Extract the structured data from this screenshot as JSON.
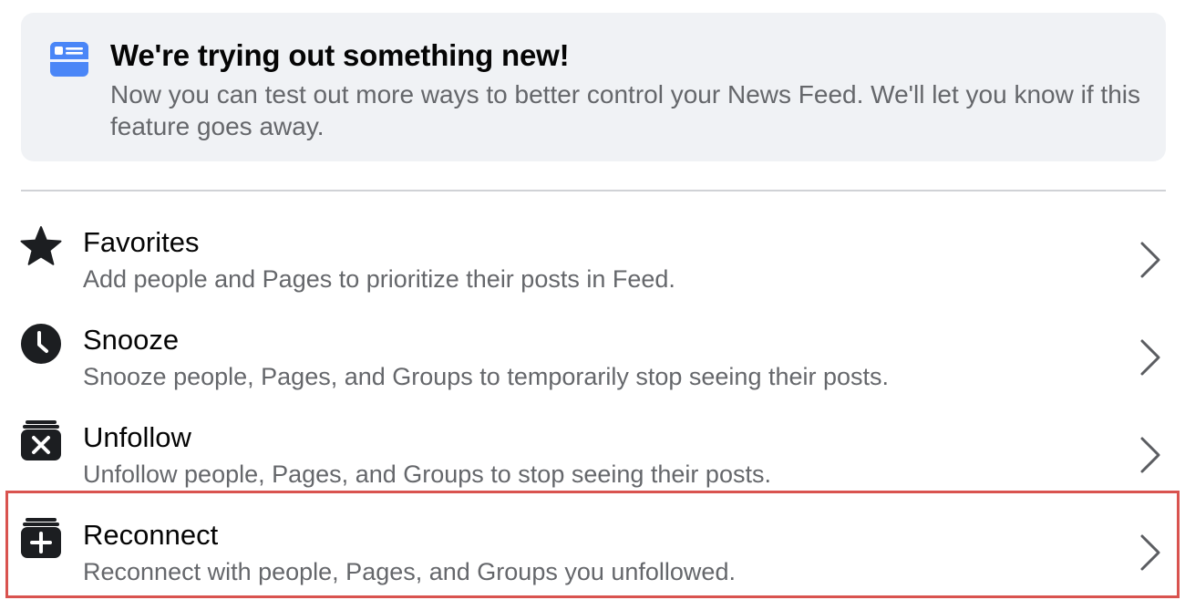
{
  "notice": {
    "icon": "news-feed-icon",
    "title": "We're trying out something new!",
    "body": "Now you can test out more ways to better control your News Feed. We'll let you know if this feature goes away.",
    "icon_color": "#4a86f7"
  },
  "items": [
    {
      "icon": "star-icon",
      "title": "Favorites",
      "description": "Add people and Pages to prioritize their posts in Feed."
    },
    {
      "icon": "clock-icon",
      "title": "Snooze",
      "description": "Snooze people, Pages, and Groups to temporarily stop seeing their posts."
    },
    {
      "icon": "unfollow-icon",
      "title": "Unfollow",
      "description": "Unfollow people, Pages, and Groups to stop seeing their posts."
    },
    {
      "icon": "reconnect-icon",
      "title": "Reconnect",
      "description": "Reconnect with people, Pages, and Groups you unfollowed.",
      "highlighted": true
    }
  ],
  "colors": {
    "highlight_border": "#d9534f",
    "secondary_text": "#65676b",
    "notice_background": "#f0f2f5"
  }
}
